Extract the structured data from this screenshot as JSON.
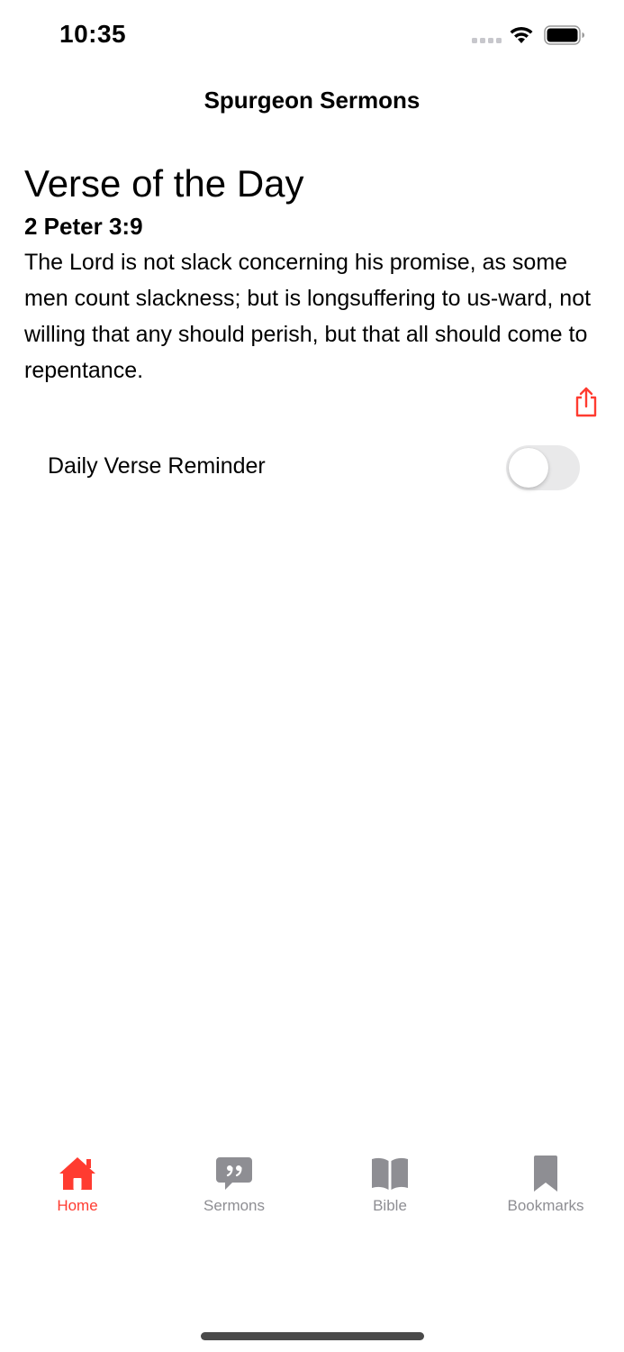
{
  "status_bar": {
    "time": "10:35"
  },
  "nav": {
    "title": "Spurgeon Sermons"
  },
  "verse_card": {
    "heading": "Verse of the Day",
    "reference": "2 Peter 3:9",
    "text": "The Lord is not slack concerning his promise, as some men count slackness; but is longsuffering to us-ward, not willing that any should perish, but that all should come to repentance.",
    "share_icon": "share-icon"
  },
  "reminder": {
    "label": "Daily Verse Reminder",
    "enabled": false
  },
  "tab_bar": {
    "tabs": [
      {
        "label": "Home",
        "icon": "house-icon",
        "active": true
      },
      {
        "label": "Sermons",
        "icon": "quote-bubble-icon",
        "active": false
      },
      {
        "label": "Bible",
        "icon": "open-book-icon",
        "active": false
      },
      {
        "label": "Bookmarks",
        "icon": "bookmark-icon",
        "active": false
      }
    ]
  },
  "colors": {
    "accent": "#ff3b30",
    "inactive": "#8e8e93",
    "toggle_off": "#e9e9ea"
  }
}
